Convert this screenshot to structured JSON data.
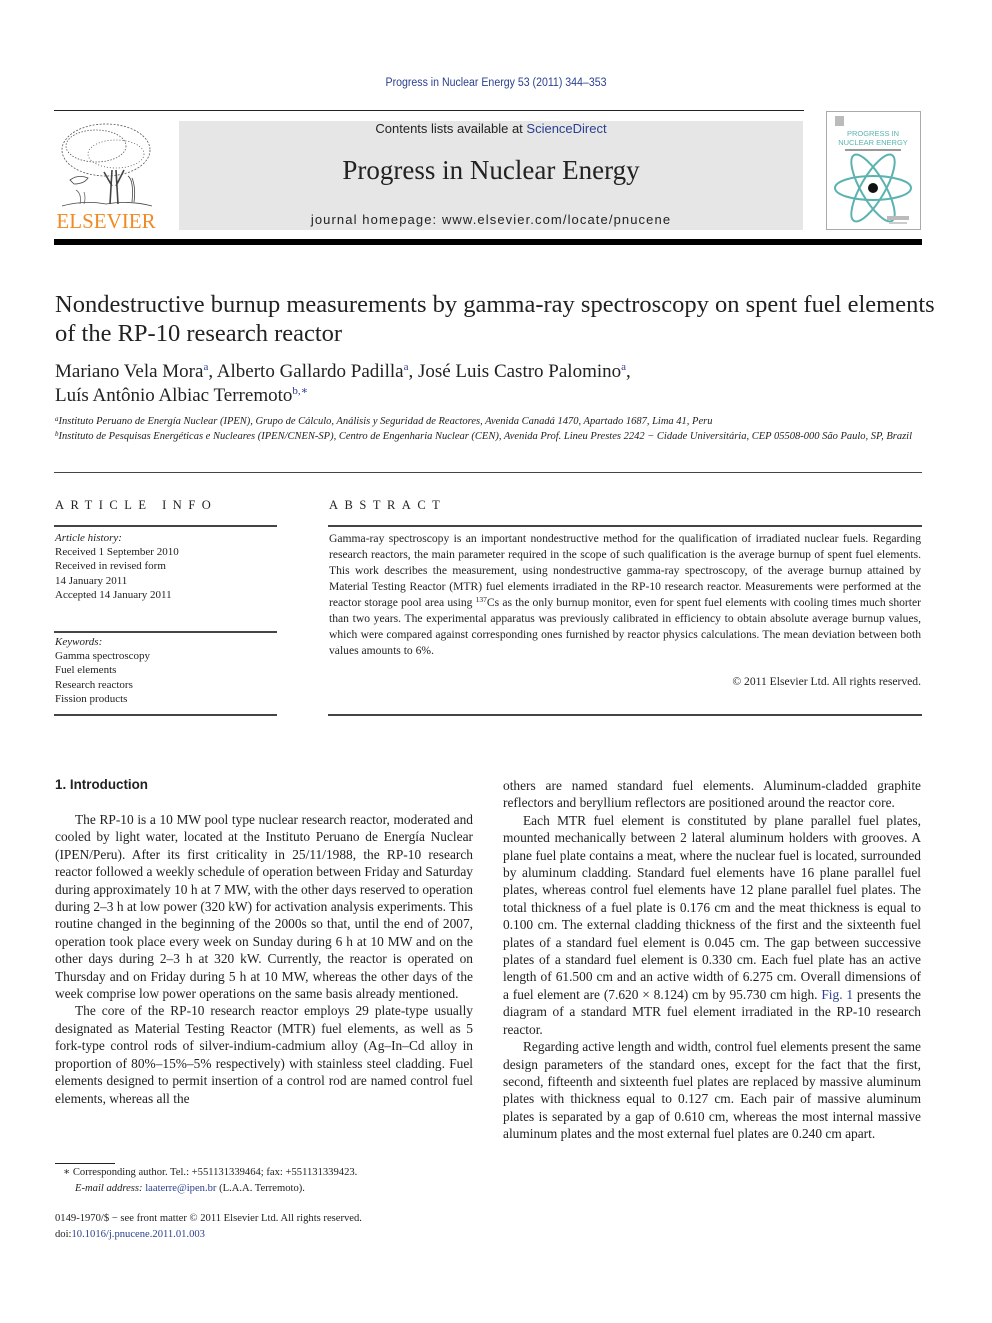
{
  "header": {
    "citation": "Progress in Nuclear Energy 53 (2011) 344–353",
    "contents_prefix": "Contents lists available at ",
    "contents_link": "ScienceDirect",
    "journal_name": "Progress in Nuclear Energy",
    "homepage": "journal homepage: www.elsevier.com/locate/pnucene",
    "publisher_logo_text": "ELSEVIER",
    "cover": {
      "title_line1": "PROGRESS IN",
      "title_line2": "NUCLEAR ENERGY",
      "accent_color": "#5ab3b0"
    }
  },
  "article": {
    "title": "Nondestructive burnup measurements by gamma-ray spectroscopy on spent fuel elements of the RP-10 research reactor",
    "authors": [
      {
        "name": "Mariano Vela Mora",
        "affil": "a",
        "sep": ", "
      },
      {
        "name": "Alberto Gallardo Padilla",
        "affil": "a",
        "sep": ", "
      },
      {
        "name": "José Luis Castro Palomino",
        "affil": "a",
        "sep": ","
      },
      {
        "name": "Luís Antônio Albiac Terremoto",
        "affil": "b,∗",
        "sep": ""
      }
    ],
    "affiliations": [
      {
        "mark": "a",
        "text": "Instituto Peruano de Energía Nuclear (IPEN), Grupo de Cálculo, Análisis y Seguridad de Reactores, Avenida Canadá 1470, Apartado 1687, Lima 41, Peru"
      },
      {
        "mark": "b",
        "text": "Instituto de Pesquisas Energéticas e Nucleares (IPEN/CNEN-SP), Centro de Engenharia Nuclear (CEN), Avenida Prof. Lineu Prestes 2242 − Cidade Universitária, CEP 05508-000 São Paulo, SP, Brazil"
      }
    ]
  },
  "article_info": {
    "heading": "ARTICLE INFO",
    "history_label": "Article history:",
    "history": [
      "Received 1 September 2010",
      "Received in revised form",
      "14 January 2011",
      "Accepted 14 January 2011"
    ],
    "keywords_label": "Keywords:",
    "keywords": [
      "Gamma spectroscopy",
      "Fuel elements",
      "Research reactors",
      "Fission products"
    ]
  },
  "abstract": {
    "heading": "ABSTRACT",
    "text_before_sup": "Gamma-ray spectroscopy is an important nondestructive method for the qualification of irradiated nuclear fuels. Regarding research reactors, the main parameter required in the scope of such qualification is the average burnup of spent fuel elements. This work describes the measurement, using nondestructive gamma-ray spectroscopy, of the average burnup attained by Material Testing Reactor (MTR) fuel elements irradiated in the RP-10 research reactor. Measurements were performed at the reactor storage pool area using ",
    "sup": "137",
    "text_after_sup": "Cs as the only burnup monitor, even for spent fuel elements with cooling times much shorter than two years. The experimental apparatus was previously calibrated in efficiency to obtain absolute average burnup values, which were compared against corresponding ones furnished by reactor physics calculations. The mean deviation between both values amounts to 6%.",
    "copyright": "© 2011 Elsevier Ltd. All rights reserved."
  },
  "body": {
    "section_heading": "1.  Introduction",
    "left_paragraphs": [
      "The RP-10 is a 10 MW pool type nuclear research reactor, moderated and cooled by light water, located at the Instituto Peruano de Energía Nuclear (IPEN/Peru). After its first criticality in 25/11/1988, the RP-10 research reactor followed a weekly schedule of operation between Friday and Saturday during approximately 10 h at 7 MW, with the other days reserved to operation during 2–3 h at low power (320 kW) for activation analysis experiments. This routine changed in the beginning of the 2000s so that, until the end of 2007, operation took place every week on Sunday during 6 h at 10 MW and on the other days during 2–3 h at 320 kW. Currently, the reactor is operated on Thursday and on Friday during 5 h at 10 MW, whereas the other days of the week comprise low power operations on the same basis already mentioned.",
      "The core of the RP-10 research reactor employs 29 plate-type usually designated as Material Testing Reactor (MTR) fuel elements, as well as 5 fork-type control rods of silver-indium-cadmium alloy (Ag–In–Cd alloy in proportion of 80%–15%–5% respectively) with stainless steel cladding. Fuel elements designed to permit insertion of a control rod are named control fuel elements, whereas all the"
    ],
    "right_p1": "others are named standard fuel elements. Aluminum-cladded graphite reflectors and beryllium reflectors are positioned around the reactor core.",
    "right_p2_before_link": "Each MTR fuel element is constituted by plane parallel fuel plates, mounted mechanically between 2 lateral aluminum holders with grooves. A plane fuel plate contains a meat, where the nuclear fuel is located, surrounded by aluminum cladding. Standard fuel elements have 16 plane parallel fuel plates, whereas control fuel elements have 12 plane parallel fuel plates. The total thickness of a fuel plate is 0.176 cm and the meat thickness is equal to 0.100 cm. The external cladding thickness of the first and the sixteenth fuel plates of a standard fuel element is 0.045 cm. The gap between successive plates of a standard fuel element is 0.330 cm. Each fuel plate has an active length of 61.500 cm and an active width of 6.275 cm. Overall dimensions of a fuel element are (7.620 × 8.124) cm by 95.730 cm high. ",
    "right_p2_link": "Fig. 1",
    "right_p2_after_link": " presents the diagram of a standard MTR fuel element irradiated in the RP-10 research reactor.",
    "right_p3": "Regarding active length and width, control fuel elements present the same design parameters of the standard ones, except for the fact that the first, second, fifteenth and sixteenth fuel plates are replaced by massive aluminum plates with thickness equal to 0.127 cm. Each pair of massive aluminum plates is separated by a gap of 0.610 cm, whereas the most internal massive aluminum plates and the most external fuel plates are 0.240 cm apart."
  },
  "footnotes": {
    "mark": "∗",
    "corresponding": " Corresponding author. Tel.: +551131339464; fax: +551131339423.",
    "email_label": "E-mail address: ",
    "email": "laaterre@ipen.br",
    "email_suffix": " (L.A.A. Terremoto).",
    "front_matter": "0149-1970/$ − see front matter © 2011 Elsevier Ltd. All rights reserved.",
    "doi_prefix": "doi:",
    "doi": "10.1016/j.pnucene.2011.01.003"
  }
}
